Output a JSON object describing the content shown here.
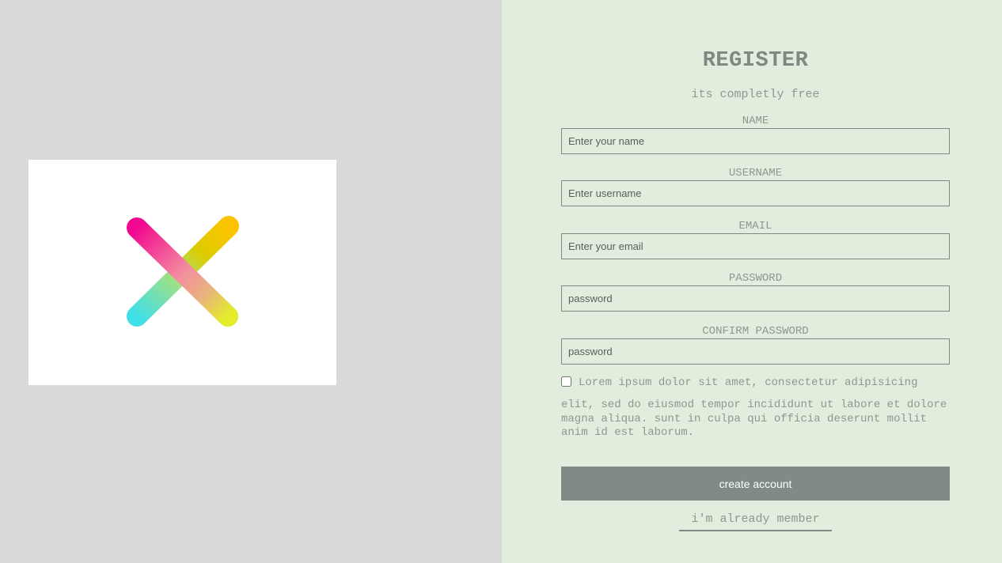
{
  "form": {
    "title": "REGISTER",
    "subtitle": "its completly free",
    "fields": [
      {
        "label": "NAME",
        "placeholder": "Enter your name"
      },
      {
        "label": "USERNAME",
        "placeholder": "Enter username"
      },
      {
        "label": "EMAIL",
        "placeholder": "Enter your email"
      },
      {
        "label": "PASSWORD",
        "placeholder": "password"
      },
      {
        "label": "CONFIRM PASSWORD",
        "placeholder": "password"
      }
    ],
    "terms_first_line": "Lorem ipsum dolor sit amet, consectetur adipisicing",
    "terms_rest": "elit, sed do eiusmod tempor incididunt ut labore et dolore magna aliqua. sunt in culpa qui officia deserunt mollit anim id est laborum.",
    "create_label": "create account",
    "member_label": "i'm already member"
  },
  "colors": {
    "left_bg": "#d9d9d8",
    "right_bg": "#e1eddd",
    "accent": "#7f8b84"
  },
  "icons": {
    "logo": "gradient-k-logo-icon"
  }
}
